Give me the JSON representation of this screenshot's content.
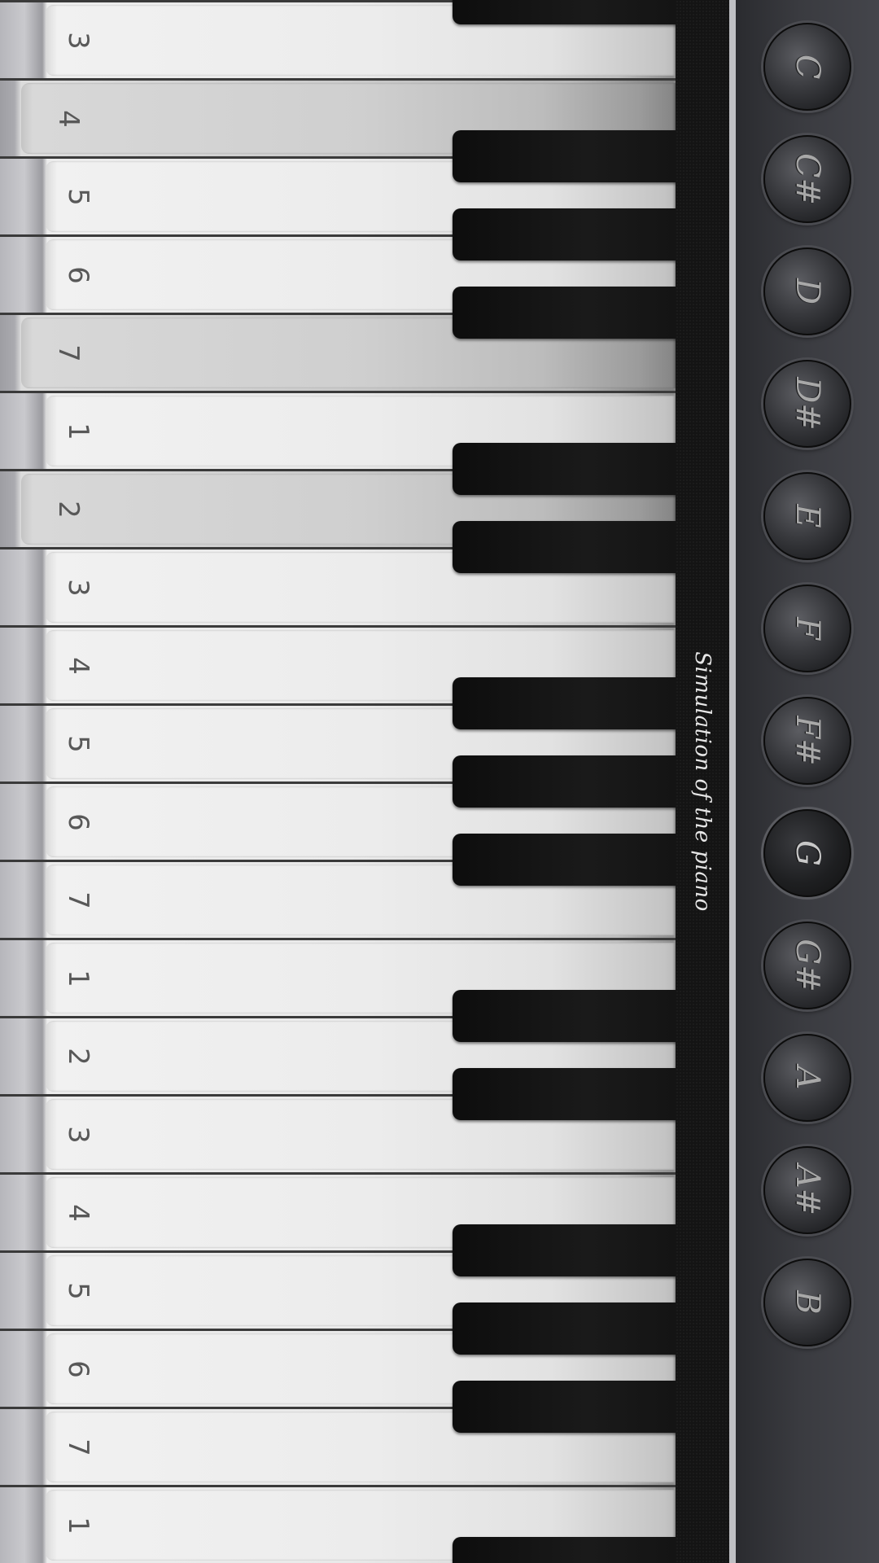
{
  "title": "Simulation of the piano",
  "white_keys": [
    {
      "label": "3",
      "pressed": false
    },
    {
      "label": "4",
      "pressed": true
    },
    {
      "label": "5",
      "pressed": false
    },
    {
      "label": "6",
      "pressed": false
    },
    {
      "label": "7",
      "pressed": true
    },
    {
      "label": "1",
      "pressed": false
    },
    {
      "label": "2",
      "pressed": true
    },
    {
      "label": "3",
      "pressed": false
    },
    {
      "label": "4",
      "pressed": false
    },
    {
      "label": "5",
      "pressed": false
    },
    {
      "label": "6",
      "pressed": false
    },
    {
      "label": "7",
      "pressed": false
    },
    {
      "label": "1",
      "pressed": false
    },
    {
      "label": "2",
      "pressed": false
    },
    {
      "label": "3",
      "pressed": false
    },
    {
      "label": "4",
      "pressed": false
    },
    {
      "label": "5",
      "pressed": false
    },
    {
      "label": "6",
      "pressed": false
    },
    {
      "label": "7",
      "pressed": false
    },
    {
      "label": "1",
      "pressed": false
    }
  ],
  "notes": [
    {
      "label": "C",
      "active": false
    },
    {
      "label": "C#",
      "active": false
    },
    {
      "label": "D",
      "active": false
    },
    {
      "label": "D#",
      "active": false
    },
    {
      "label": "E",
      "active": false
    },
    {
      "label": "F",
      "active": false
    },
    {
      "label": "F#",
      "active": false
    },
    {
      "label": "G",
      "active": true
    },
    {
      "label": "G#",
      "active": false
    },
    {
      "label": "A",
      "active": false
    },
    {
      "label": "A#",
      "active": false
    },
    {
      "label": "B",
      "active": false
    }
  ]
}
